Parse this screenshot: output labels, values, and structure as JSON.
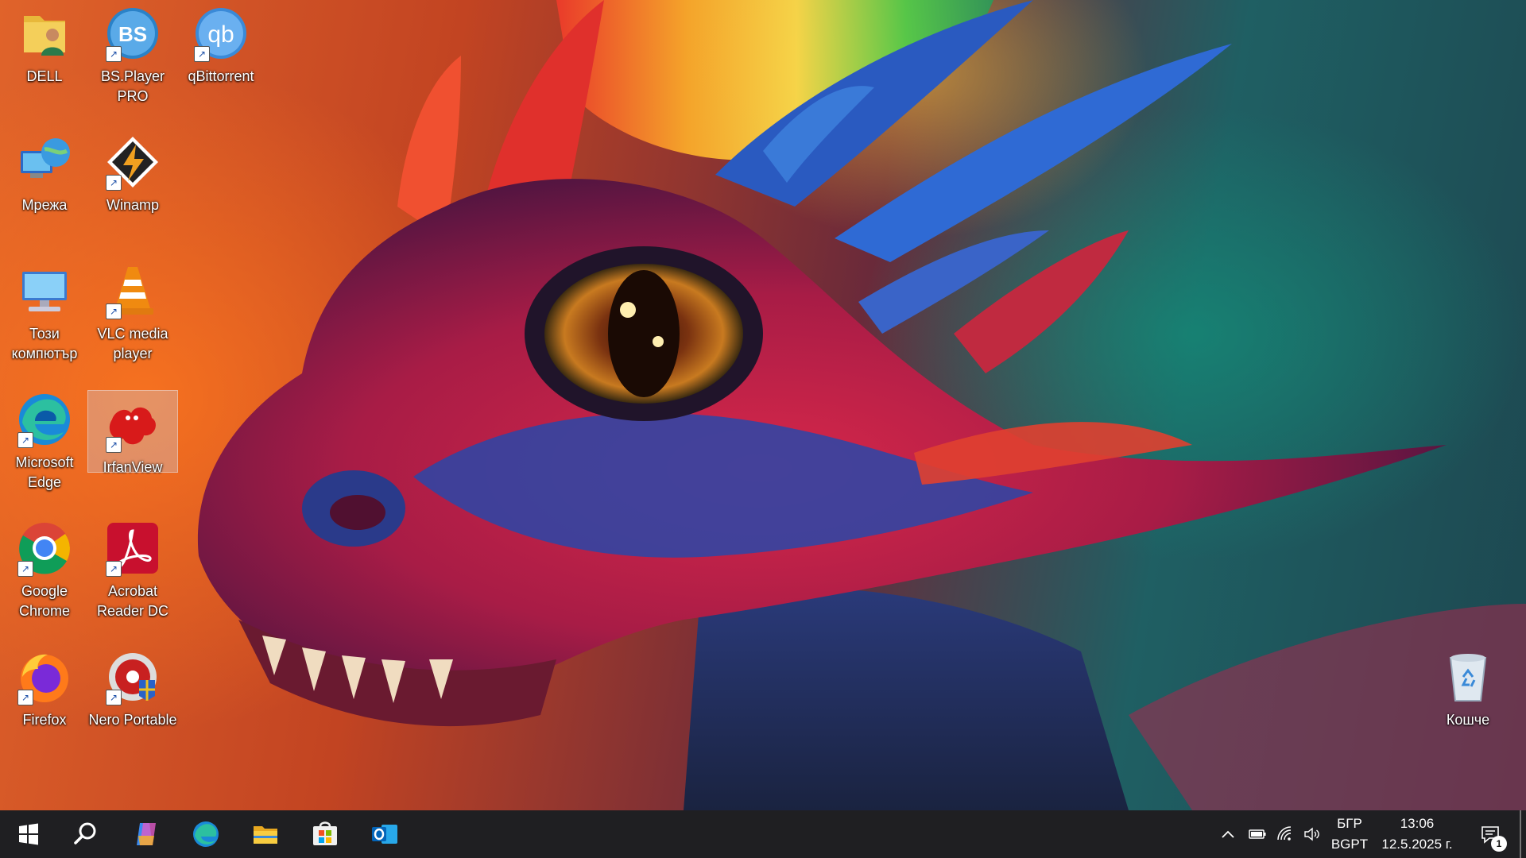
{
  "desktop": {
    "icons": [
      {
        "label": "DELL",
        "icon": "user-folder-icon",
        "shortcut": false
      },
      {
        "label": "BS.Player PRO",
        "icon": "bsplayer-icon",
        "shortcut": true
      },
      {
        "label": "qBittorrent",
        "icon": "qbittorrent-icon",
        "shortcut": true
      },
      {
        "label": "Мрежа",
        "icon": "network-icon",
        "shortcut": false
      },
      {
        "label": "Winamp",
        "icon": "winamp-icon",
        "shortcut": true
      },
      {
        "label": "Този компютър",
        "icon": "this-pc-icon",
        "shortcut": false
      },
      {
        "label": "VLC media player",
        "icon": "vlc-icon",
        "shortcut": true
      },
      {
        "label": "Microsoft Edge",
        "icon": "edge-icon",
        "shortcut": true
      },
      {
        "label": "IrfanView",
        "icon": "irfanview-icon",
        "shortcut": true,
        "selected": true
      },
      {
        "label": "Google Chrome",
        "icon": "chrome-icon",
        "shortcut": true
      },
      {
        "label": "Acrobat Reader DC",
        "icon": "acrobat-icon",
        "shortcut": true
      },
      {
        "label": "Firefox",
        "icon": "firefox-icon",
        "shortcut": true
      },
      {
        "label": "Nero Portable",
        "icon": "nero-icon",
        "shortcut": true
      },
      {
        "label": "Кошче",
        "icon": "recycle-bin-icon",
        "shortcut": false
      }
    ]
  },
  "taskbar": {
    "pinned": [
      "start-icon",
      "search-icon",
      "copilot-icon",
      "edge-icon",
      "file-explorer-icon",
      "microsoft-store-icon",
      "outlook-icon"
    ],
    "tray": {
      "icons": [
        "chevron-up-icon",
        "battery-icon",
        "wifi-icon",
        "volume-icon"
      ],
      "language_line1": "БГР",
      "language_line2": "BGPT",
      "time": "13:06",
      "date": "12.5.2025 г.",
      "notification_count": "1"
    }
  },
  "colors": {
    "taskbar_bg": "#1f1f22",
    "accent_blue": "#0078d4"
  }
}
